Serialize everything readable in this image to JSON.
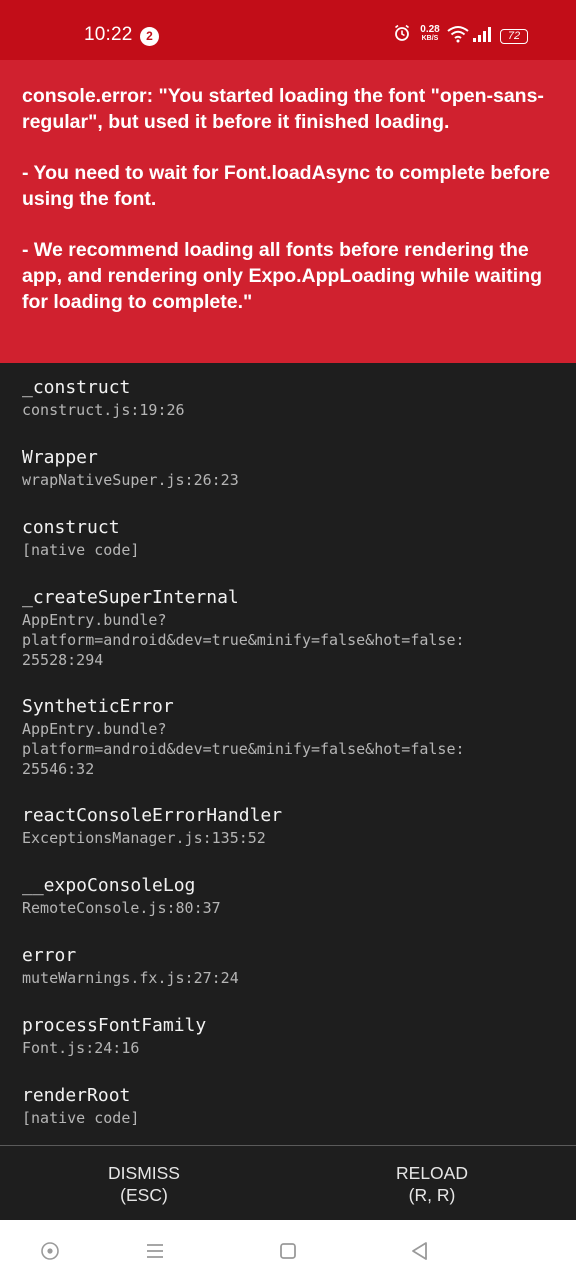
{
  "status_bar": {
    "time": "10:22",
    "notification_count": "2",
    "net_speed_value": "0.28",
    "net_speed_unit": "KB/S",
    "battery_level": "72"
  },
  "error": {
    "message": "console.error: \"You started loading the font \"open-sans-regular\", but used it before it finished loading.\n\n- You need to wait for Font.loadAsync to complete before using the font.\n\n- We recommend loading all fonts before rendering the app, and rendering only Expo.AppLoading while waiting for loading to complete.\""
  },
  "stack_frames": [
    {
      "name": "_construct",
      "location": "construct.js:19:26"
    },
    {
      "name": "Wrapper",
      "location": "wrapNativeSuper.js:26:23"
    },
    {
      "name": "construct",
      "location": "[native code]"
    },
    {
      "name": "_createSuperInternal",
      "location": "AppEntry.bundle?\nplatform=android&dev=true&minify=false&hot=false:\n25528:294"
    },
    {
      "name": "SyntheticError",
      "location": "AppEntry.bundle?\nplatform=android&dev=true&minify=false&hot=false:\n25546:32"
    },
    {
      "name": "reactConsoleErrorHandler",
      "location": "ExceptionsManager.js:135:52"
    },
    {
      "name": "__expoConsoleLog",
      "location": "RemoteConsole.js:80:37"
    },
    {
      "name": "error",
      "location": "muteWarnings.fx.js:27:24"
    },
    {
      "name": "processFontFamily",
      "location": "Font.js:24:16"
    },
    {
      "name": "renderRoot",
      "location": "[native code]"
    }
  ],
  "footer": {
    "dismiss_label": "DISMISS\n(ESC)",
    "reload_label": "RELOAD\n(R, R)"
  },
  "nav_bar": {
    "icons": [
      "home-circle-icon",
      "menu-icon",
      "square-icon",
      "back-triangle-icon"
    ]
  },
  "colors": {
    "status_bar_bg": "#c20d18",
    "error_bg": "#d0212f",
    "stack_bg": "#1e1e1e"
  }
}
